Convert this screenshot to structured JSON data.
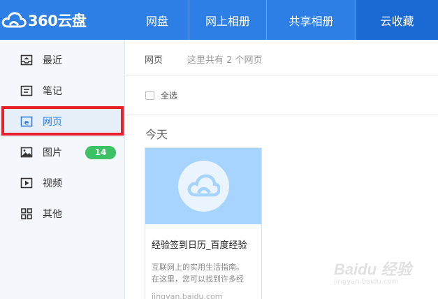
{
  "app": {
    "logo_text": "360云盘"
  },
  "nav": {
    "items": [
      {
        "label": "网盘"
      },
      {
        "label": "网上相册"
      },
      {
        "label": "共享相册"
      },
      {
        "label": "云收藏"
      }
    ],
    "active_index": 3
  },
  "sidebar": {
    "items": [
      {
        "label": "最近",
        "icon": "inbox-icon"
      },
      {
        "label": "笔记",
        "icon": "note-icon"
      },
      {
        "label": "网页",
        "icon": "webpage-icon"
      },
      {
        "label": "图片",
        "icon": "image-icon",
        "badge": "14"
      },
      {
        "label": "视频",
        "icon": "video-icon"
      },
      {
        "label": "其他",
        "icon": "grid-icon"
      }
    ],
    "active_index": 2
  },
  "main": {
    "breadcrumb": "网页",
    "count_text": "这里共有 2 个网页",
    "select_all_label": "全选",
    "day_heading": "今天",
    "card": {
      "title": "经验签到日历_百度经验",
      "desc_line1": "互联网上的实用生活指南。",
      "desc_line2": "在这里，您可以找到许多经",
      "url": "jingyan.baidu.com"
    }
  },
  "watermark": {
    "text": "Baidu 经验",
    "sub": "jingyan.baidu.com"
  },
  "colors": {
    "topbar": "#2d7fe6",
    "topbar_active": "#1a68d1",
    "highlight": "#e8202a",
    "badge": "#3dc165",
    "thumb": "#a7d4ff"
  }
}
